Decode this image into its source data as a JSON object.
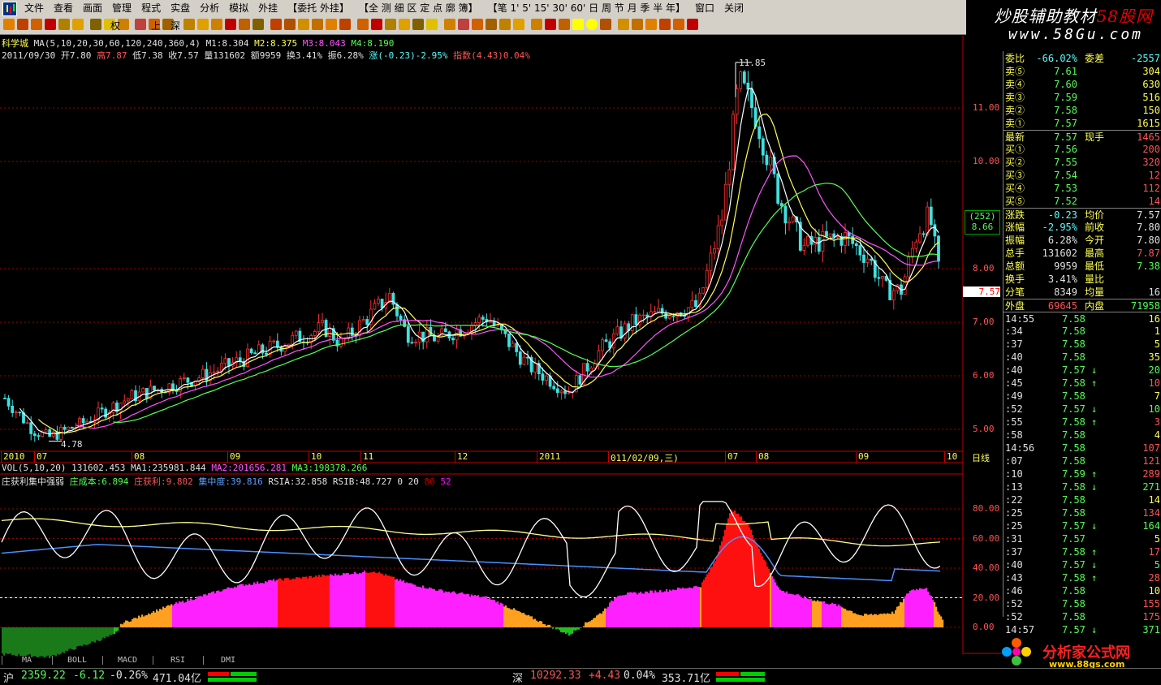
{
  "menu": [
    "文件",
    "查看",
    "画面",
    "管理",
    "程式",
    "实盘",
    "分析",
    "模拟",
    "外挂",
    "【委托 外挂】",
    "【全 测 细 区 定 点 廓 簿】",
    "【笔 1' 5' 15' 30' 60' 日 周 节 月 季 半 年】",
    "窗口",
    "关闭"
  ],
  "banner": {
    "line1a": "炒股辅助教材",
    "line1b": "58股网",
    "line2": "www.58Gu.com"
  },
  "toolbar": {
    "quan": "权",
    "jia": "上",
    "shen": "深"
  },
  "main_chart": {
    "name": "科学城",
    "ma_label": "MA(5,10,20,30,60,120,240,360,4)",
    "ma1": "M1:8.304",
    "ma2": "M2:8.375",
    "ma3": "M3:8.043",
    "ma4": "M4:8.190",
    "info_date": "2011/09/30",
    "info_open": "开7.80",
    "info_high": "高7.87",
    "info_low": "低7.38",
    "info_close": "收7.57",
    "info_vol": "量131602",
    "info_amt": "额9959",
    "info_turn": "换3.41%",
    "info_amp": "振6.28%",
    "info_chg": "涨(-0.23)-2.95%",
    "info_idx": "指数(4.43)0.04%",
    "high_label": "11.85",
    "low_label": "4.78",
    "price_axis": [
      "11.00",
      "10.00",
      "8.00",
      "7.00",
      "6.00",
      "5.00"
    ],
    "axis_box1": "(252)",
    "axis_box2": "8.66",
    "cur_price": "7.57",
    "date_axis": [
      "2010",
      "07",
      "08",
      "09",
      "10",
      "11",
      "12",
      "2011",
      "011/02/09,三)",
      "07",
      "08",
      "09",
      "10"
    ],
    "period": "日线"
  },
  "vol_line": {
    "name": "VOL(5,10,20)",
    "v": "131602.453",
    "a1": "MA1:235981.844",
    "a2": "MA2:201656.281",
    "a3": "MA3:198378.266"
  },
  "indicator": {
    "name": "庄获利集中强弱",
    "cost": "庄成本:6.894",
    "profit": "庄获利:9.802",
    "conc": "集中度:39.816",
    "rsia": "RSIA:32.858",
    "rsib": "RSIB:48.727",
    "z": "0",
    "n20": "20",
    "n80": "80",
    "n52": "52",
    "axis": [
      "80.00",
      "60.00",
      "40.00",
      "20.00",
      "0.00"
    ]
  },
  "tabs": [
    "MA",
    "BOLL",
    "MACD",
    "RSI",
    "DMI"
  ],
  "quote": {
    "top": {
      "weibi_l": "委比",
      "weibi_v": "-66.02%",
      "weicha_l": "委差",
      "weicha_v": "-2557"
    },
    "sells": [
      {
        "l": "卖⑤",
        "p": "7.61",
        "v": "304"
      },
      {
        "l": "卖④",
        "p": "7.60",
        "v": "630"
      },
      {
        "l": "卖③",
        "p": "7.59",
        "v": "516"
      },
      {
        "l": "卖②",
        "p": "7.58",
        "v": "150"
      },
      {
        "l": "卖①",
        "p": "7.57",
        "v": "1615"
      }
    ],
    "latest": {
      "l": "最新",
      "p": "7.57",
      "l2": "现手",
      "v": "1465"
    },
    "buys": [
      {
        "l": "买①",
        "p": "7.56",
        "v": "200"
      },
      {
        "l": "买②",
        "p": "7.55",
        "v": "320"
      },
      {
        "l": "买③",
        "p": "7.54",
        "v": "12"
      },
      {
        "l": "买④",
        "p": "7.53",
        "v": "112"
      },
      {
        "l": "买⑤",
        "p": "7.52",
        "v": "14"
      }
    ],
    "stats": [
      {
        "l": "涨跌",
        "v": "-0.23",
        "l2": "均价",
        "v2": "7.57"
      },
      {
        "l": "涨幅",
        "v": "-2.95%",
        "l2": "前收",
        "v2": "7.80"
      },
      {
        "l": "振幅",
        "v": "6.28%",
        "l2": "今开",
        "v2": "7.80"
      },
      {
        "l": "总手",
        "v": "131602",
        "l2": "最高",
        "v2": "7.87"
      },
      {
        "l": "总额",
        "v": "9959",
        "l2": "最低",
        "v2": "7.38"
      },
      {
        "l": "换手",
        "v": "3.41%",
        "l2": "量比",
        "v2": ""
      },
      {
        "l": "分笔",
        "v": "8349",
        "l2": "均量",
        "v2": "16"
      }
    ],
    "outer": {
      "l": "外盘",
      "v": "69645",
      "l2": "内盘",
      "v2": "71958"
    },
    "ticks": [
      {
        "t": "14:55",
        "p": "7.58",
        "a": "",
        "v": "16"
      },
      {
        "t": ":34",
        "p": "7.58",
        "a": "",
        "v": "1"
      },
      {
        "t": ":37",
        "p": "7.58",
        "a": "",
        "v": "5"
      },
      {
        "t": ":40",
        "p": "7.58",
        "a": "",
        "v": "35"
      },
      {
        "t": ":40",
        "p": "7.57",
        "a": "↓",
        "v": "20"
      },
      {
        "t": ":45",
        "p": "7.58",
        "a": "↑",
        "v": "10"
      },
      {
        "t": ":49",
        "p": "7.58",
        "a": "",
        "v": "7"
      },
      {
        "t": ":52",
        "p": "7.57",
        "a": "↓",
        "v": "10"
      },
      {
        "t": ":55",
        "p": "7.58",
        "a": "↑",
        "v": "3"
      },
      {
        "t": ":58",
        "p": "7.58",
        "a": "",
        "v": "4"
      },
      {
        "t": "14:56",
        "p": "7.58",
        "a": "",
        "v": "107"
      },
      {
        "t": ":07",
        "p": "7.58",
        "a": "",
        "v": "121"
      },
      {
        "t": ":10",
        "p": "7.59",
        "a": "↑",
        "v": "289"
      },
      {
        "t": ":13",
        "p": "7.58",
        "a": "↓",
        "v": "271"
      },
      {
        "t": ":22",
        "p": "7.58",
        "a": "",
        "v": "14"
      },
      {
        "t": ":25",
        "p": "7.58",
        "a": "",
        "v": "134"
      },
      {
        "t": ":25",
        "p": "7.57",
        "a": "↓",
        "v": "164"
      },
      {
        "t": ":31",
        "p": "7.57",
        "a": "",
        "v": "5"
      },
      {
        "t": ":37",
        "p": "7.58",
        "a": "↑",
        "v": "17"
      },
      {
        "t": ":40",
        "p": "7.57",
        "a": "↓",
        "v": "5"
      },
      {
        "t": ":43",
        "p": "7.58",
        "a": "↑",
        "v": "28"
      },
      {
        "t": ":46",
        "p": "7.58",
        "a": "",
        "v": "10"
      },
      {
        "t": ":52",
        "p": "7.58",
        "a": "",
        "v": "155"
      },
      {
        "t": ":52",
        "p": "7.58",
        "a": "",
        "v": "175"
      },
      {
        "t": "14:57",
        "p": "7.57",
        "a": "↓",
        "v": "371"
      }
    ]
  },
  "status": {
    "sh": "沪",
    "sh_idx": "2359.22",
    "sh_chg": "-6.12",
    "sh_pct": "-0.26%",
    "sh_amt": "471.04亿",
    "sz": "深",
    "sz_idx": "10292.33",
    "sz_chg": "+4.43",
    "sz_pct": "0.04%",
    "sz_amt": "353.71亿"
  },
  "logo2": {
    "text": "分析家公式网",
    "url": "www.88gs.com"
  }
}
